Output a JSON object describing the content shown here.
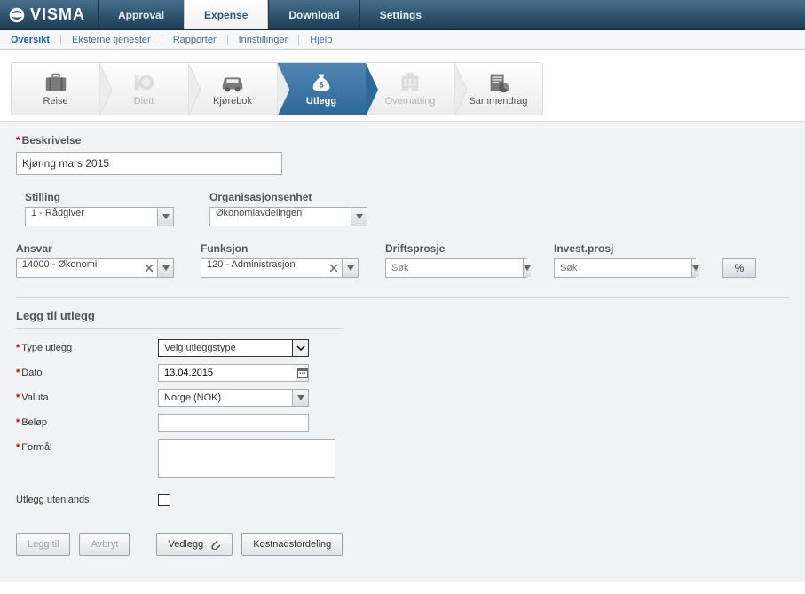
{
  "logo_text": "VISMA",
  "top_tabs": {
    "approval": "Approval",
    "expense": "Expense",
    "download": "Download",
    "settings": "Settings"
  },
  "sub_nav": {
    "oversikt": "Oversikt",
    "eksterne": "Eksterne tjenester",
    "rapporter": "Rapporter",
    "innstillinger": "Innstillinger",
    "hjelp": "Hjelp"
  },
  "wizard": {
    "reise": "Reise",
    "diett": "Diett",
    "kjorebok": "Kjørebok",
    "utlegg": "Utlegg",
    "overnatting": "Overnatting",
    "sammendrag": "Sammendrag"
  },
  "beskrivelse_label": "Beskrivelse",
  "beskrivelse_value": "Kjøring mars 2015",
  "fields": {
    "stilling": {
      "label": "Stilling",
      "value": "1 - Rådgiver"
    },
    "org": {
      "label": "Organisasjonsenhet",
      "value": "Økonomiavdelingen"
    },
    "ansvar": {
      "label": "Ansvar",
      "value": "14000 - Økonomi"
    },
    "funksjon": {
      "label": "Funksjon",
      "value": "120 - Administrasjon"
    },
    "driftsprosje": {
      "label": "Driftsprosje",
      "placeholder": "Søk"
    },
    "investprosj": {
      "label": "Invest.prosj",
      "placeholder": "Søk"
    },
    "pct": "%"
  },
  "utlegg": {
    "header": "Legg til utlegg",
    "type_label": "Type utlegg",
    "type_value": "Velg utleggstype",
    "dato_label": "Dato",
    "dato_value": "13.04.2015",
    "valuta_label": "Valuta",
    "valuta_value": "Norge (NOK)",
    "belop_label": "Beløp",
    "formal_label": "Formål",
    "utenlands_label": "Utlegg utenlands"
  },
  "buttons": {
    "leggtil": "Legg til",
    "avbryt": "Avbryt",
    "vedlegg": "Vedlegg",
    "kostnadsfordeling": "Kostnadsfordeling"
  }
}
